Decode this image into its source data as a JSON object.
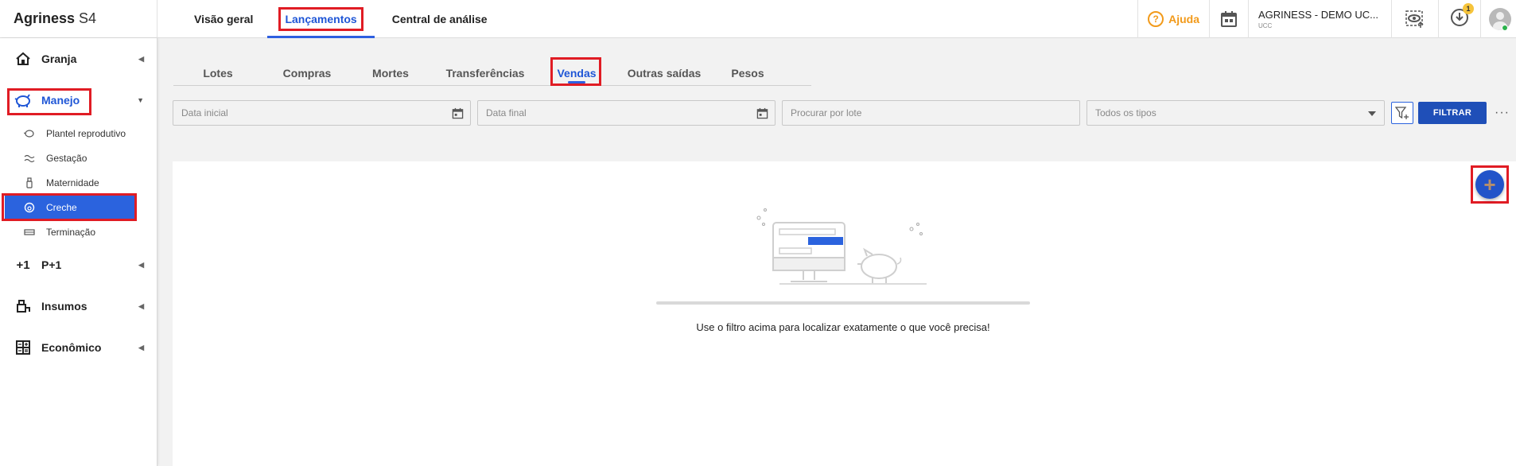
{
  "app": {
    "brand_bold": "Agriness",
    "brand_rest": "S4"
  },
  "top_tabs": [
    {
      "label": "Visão geral"
    },
    {
      "label": "Lançamentos"
    },
    {
      "label": "Central de análise"
    }
  ],
  "header": {
    "help_label": "Ajuda",
    "company_name": "AGRINESS - DEMO UC...",
    "company_sub": "UCC",
    "download_badge": "1"
  },
  "sidebar": {
    "groups": [
      {
        "label": "Granja"
      },
      {
        "label": "Manejo"
      },
      {
        "label": "P+1"
      },
      {
        "label": "Insumos"
      },
      {
        "label": "Econômico"
      }
    ],
    "manejo_items": [
      {
        "label": "Plantel reprodutivo"
      },
      {
        "label": "Gestação"
      },
      {
        "label": "Maternidade"
      },
      {
        "label": "Creche"
      },
      {
        "label": "Terminação"
      }
    ],
    "p1_icon_text": "+1"
  },
  "sub_tabs": [
    {
      "label": "Lotes"
    },
    {
      "label": "Compras"
    },
    {
      "label": "Mortes"
    },
    {
      "label": "Transferências"
    },
    {
      "label": "Vendas"
    },
    {
      "label": "Outras saídas"
    },
    {
      "label": "Pesos"
    }
  ],
  "filters": {
    "start_date_placeholder": "Data inicial",
    "end_date_placeholder": "Data final",
    "lot_search_placeholder": "Procurar por lote",
    "type_select_value": "Todos os tipos",
    "filter_button": "FILTRAR",
    "more_label": "···"
  },
  "content": {
    "empty_message": "Use o filtro acima para localizar exatamente o que você precisa!",
    "fab_label": "+"
  },
  "colors": {
    "accent": "#2b63de",
    "highlight": "#e01c24",
    "help": "#f29a1a"
  }
}
